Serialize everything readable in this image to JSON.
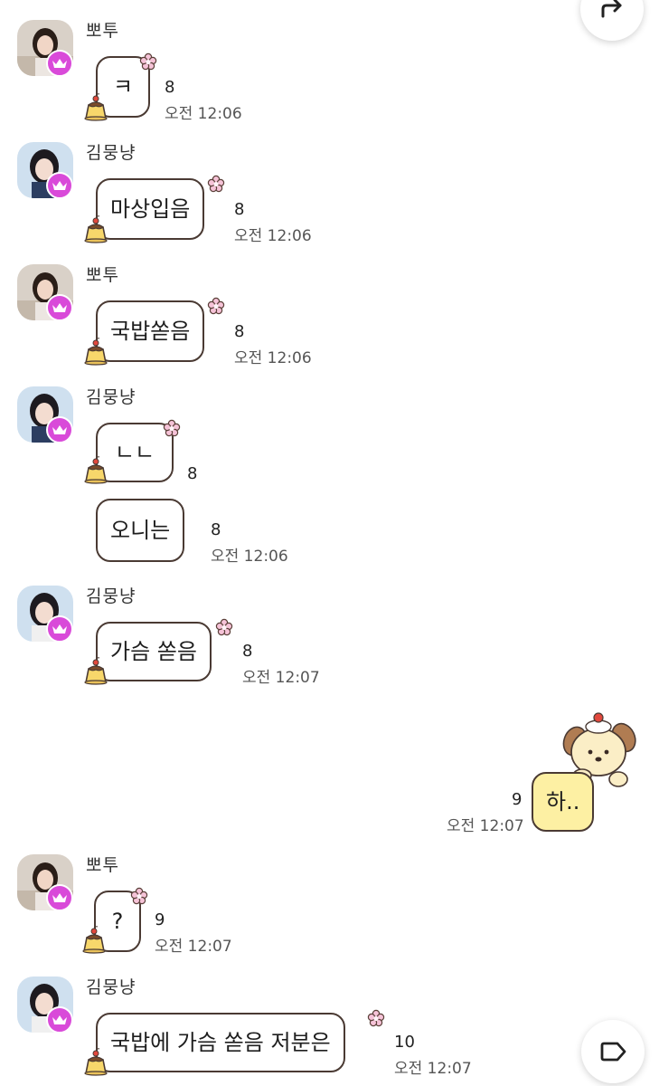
{
  "colors": {
    "crown_badge": "#d94ad9",
    "bubble_border": "#4a3a33",
    "my_bubble": "#fdf0a3",
    "flower": "#f6c3d8"
  },
  "icons": {
    "share": "share-arrow-icon",
    "tag": "tag-icon",
    "crown": "crown-icon",
    "pudding": "pudding-sticker-icon",
    "flower": "flower-icon",
    "dog_sticker": "puppy-sticker-icon"
  },
  "messages": [
    {
      "sender": "뽀투",
      "text": "ㅋ",
      "count": "8",
      "time": "오전 12:06"
    },
    {
      "sender": "김뭉냥",
      "text": "마상입음",
      "count": "8",
      "time": "오전 12:06"
    },
    {
      "sender": "뽀투",
      "text": "국밥쏟음",
      "count": "8",
      "time": "오전 12:06"
    },
    {
      "sender": "김뭉냥",
      "text": "ㄴㄴ",
      "count": "8",
      "time": ""
    },
    {
      "sender": "",
      "text": "오니는",
      "count": "8",
      "time": "오전 12:06"
    },
    {
      "sender": "김뭉냥",
      "text": "가슴 쏟음",
      "count": "8",
      "time": "오전 12:07"
    },
    {
      "sender": "me",
      "text": "하..",
      "count": "9",
      "time": "오전 12:07"
    },
    {
      "sender": "뽀투",
      "text": "?",
      "count": "9",
      "time": "오전 12:07"
    },
    {
      "sender": "김뭉냥",
      "text": "국밥에 가슴 쏟음 저분은",
      "count": "10",
      "time": "오전 12:07"
    }
  ]
}
